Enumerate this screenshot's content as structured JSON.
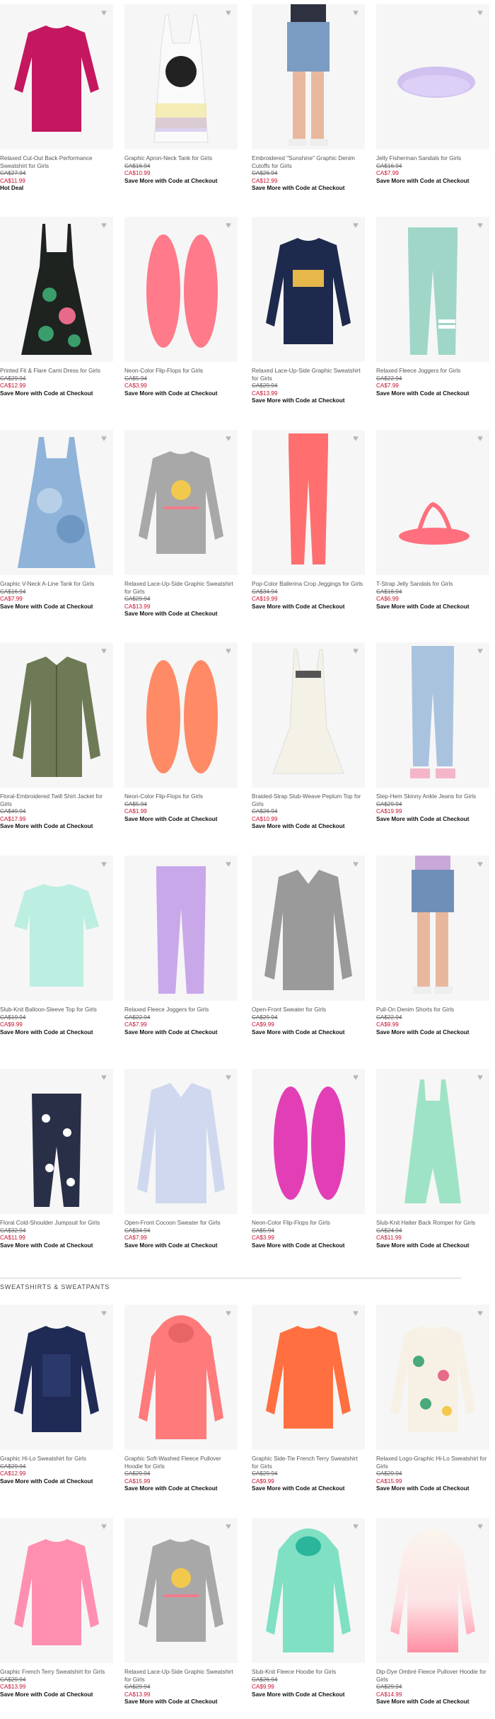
{
  "colors": {
    "sale": "#c8102e",
    "heart": "#b8b8b8"
  },
  "icons": {
    "wishlist": "heart-outline-icon",
    "wishlist_glyph": "♥"
  },
  "section2": {
    "title": "SWEATSHIRTS & SWEATPANTS"
  },
  "rows": [
    [
      {
        "name": "Relaxed Cut-Out Back Performance Sweatshirt for Girls",
        "was": "CA$27.94",
        "now": "CA$11.99",
        "promo": "Hot Deal"
      },
      {
        "name": "Graphic Apron-Neck Tank for Girls",
        "was": "CA$16.94",
        "now": "CA$10.99",
        "promo": "Save More with Code at Checkout"
      },
      {
        "name": "Embroidered \"Sunshine\" Graphic Denim Cutoffs for Girls",
        "was": "CA$26.94",
        "now": "CA$12.99",
        "promo": "Save More with Code at Checkout"
      },
      {
        "name": "Jelly Fisherman Sandals for Girls",
        "was": "CA$16.94",
        "now": "CA$7.99",
        "promo": "Save More with Code at Checkout"
      }
    ],
    [
      {
        "name": "Printed Fit & Flare Cami Dress for Girls",
        "was": "CA$29.94",
        "now": "CA$12.99",
        "promo": "Save More with Code at Checkout"
      },
      {
        "name": "Neon-Color Flip-Flops for Girls",
        "was": "CA$5.94",
        "now": "CA$3.99",
        "promo": "Save More with Code at Checkout"
      },
      {
        "name": "Relaxed Lace-Up-Side Graphic Sweatshirt for Girls",
        "was": "CA$29.94",
        "now": "CA$13.99",
        "promo": "Save More with Code at Checkout"
      },
      {
        "name": "Relaxed Fleece Joggers for Girls",
        "was": "CA$22.94",
        "now": "CA$7.99",
        "promo": "Save More with Code at Checkout"
      }
    ],
    [
      {
        "name": "Graphic V-Neck A-Line Tank for Girls",
        "was": "CA$16.94",
        "now": "CA$7.99",
        "promo": "Save More with Code at Checkout"
      },
      {
        "name": "Relaxed Lace-Up-Side Graphic Sweatshirt for Girls",
        "was": "CA$29.94",
        "now": "CA$13.99",
        "promo": "Save More with Code at Checkout"
      },
      {
        "name": "Pop-Color Ballerina Crop Jeggings for Girls",
        "was": "CA$34.94",
        "now": "CA$19.99",
        "promo": "Save More with Code at Checkout"
      },
      {
        "name": "T-Strap Jelly Sandals for Girls",
        "was": "CA$16.94",
        "now": "CA$6.99",
        "promo": "Save More with Code at Checkout"
      }
    ],
    [
      {
        "name": "Floral-Embroidered Twill Shirt Jacket for Girls",
        "was": "CA$49.94",
        "now": "CA$17.99",
        "promo": "Save More with Code at Checkout"
      },
      {
        "name": "Neon-Color Flip-Flops for Girls",
        "was": "CA$5.94",
        "now": "CA$1.99",
        "promo": "Save More with Code at Checkout"
      },
      {
        "name": "Braided-Strap Slub-Weave Peplum Top for Girls",
        "was": "CA$26.94",
        "now": "CA$10.99",
        "promo": "Save More with Code at Checkout"
      },
      {
        "name": "Step-Hem Skinny Ankle Jeans for Girls",
        "was": "CA$29.94",
        "now": "CA$19.99",
        "promo": "Save More with Code at Checkout"
      }
    ],
    [
      {
        "name": "Slub-Knit Balloon-Sleeve Top for Girls",
        "was": "CA$19.94",
        "now": "CA$9.99",
        "promo": "Save More with Code at Checkout"
      },
      {
        "name": "Relaxed Fleece Joggers for Girls",
        "was": "CA$22.94",
        "now": "CA$7.99",
        "promo": "Save More with Code at Checkout"
      },
      {
        "name": "Open-Front Sweater for Girls",
        "was": "CA$29.94",
        "now": "CA$9.99",
        "promo": "Save More with Code at Checkout"
      },
      {
        "name": "Pull-On Denim Shorts for Girls",
        "was": "CA$22.94",
        "now": "CA$9.99",
        "promo": "Save More with Code at Checkout"
      }
    ],
    [
      {
        "name": "Floral Cold-Shoulder Jumpsuit for Girls",
        "was": "CA$32.94",
        "now": "CA$11.99",
        "promo": "Save More with Code at Checkout"
      },
      {
        "name": "Open-Front Cocoon Sweater for Girls",
        "was": "CA$34.94",
        "now": "CA$7.99",
        "promo": "Save More with Code at Checkout"
      },
      {
        "name": "Neon-Color Flip-Flops for Girls",
        "was": "CA$5.94",
        "now": "CA$3.99",
        "promo": "Save More with Code at Checkout"
      },
      {
        "name": "Slub-Knit Halter Back Romper for Girls",
        "was": "CA$24.94",
        "now": "CA$11.99",
        "promo": "Save More with Code at Checkout"
      }
    ],
    [
      {
        "name": "Graphic Hi-Lo Sweatshirt for Girls",
        "was": "CA$29.94",
        "now": "CA$12.99",
        "promo": "Save More with Code at Checkout"
      },
      {
        "name": "Graphic Soft-Washed Fleece Pullover Hoodie for Girls",
        "was": "CA$29.94",
        "now": "CA$15.99",
        "promo": "Save More with Code at Checkout"
      },
      {
        "name": "Graphic Side-Tie French Terry Sweatshirt for Girls",
        "was": "CA$29.94",
        "now": "CA$9.99",
        "promo": "Save More with Code at Checkout"
      },
      {
        "name": "Relaxed Logo-Graphic Hi-Lo Sweatshirt for Girls",
        "was": "CA$29.94",
        "now": "CA$15.99",
        "promo": "Save More with Code at Checkout"
      }
    ],
    [
      {
        "name": "Graphic French Terry Sweatshirt for Girls",
        "was": "CA$29.94",
        "now": "CA$13.99",
        "promo": "Save More with Code at Checkout"
      },
      {
        "name": "Relaxed Lace-Up-Side Graphic Sweatshirt for Girls",
        "was": "CA$29.94",
        "now": "CA$13.99",
        "promo": "Save More with Code at Checkout"
      },
      {
        "name": "Slub-Knit Fleece Hoodie for Girls",
        "was": "CA$26.94",
        "now": "CA$9.99",
        "promo": "Save More with Code at Checkout"
      },
      {
        "name": "Dip-Dye Ombré Fleece Pullover Hoodie for Girls",
        "was": "CA$29.94",
        "now": "CA$14.99",
        "promo": "Save More with Code at Checkout"
      }
    ]
  ]
}
